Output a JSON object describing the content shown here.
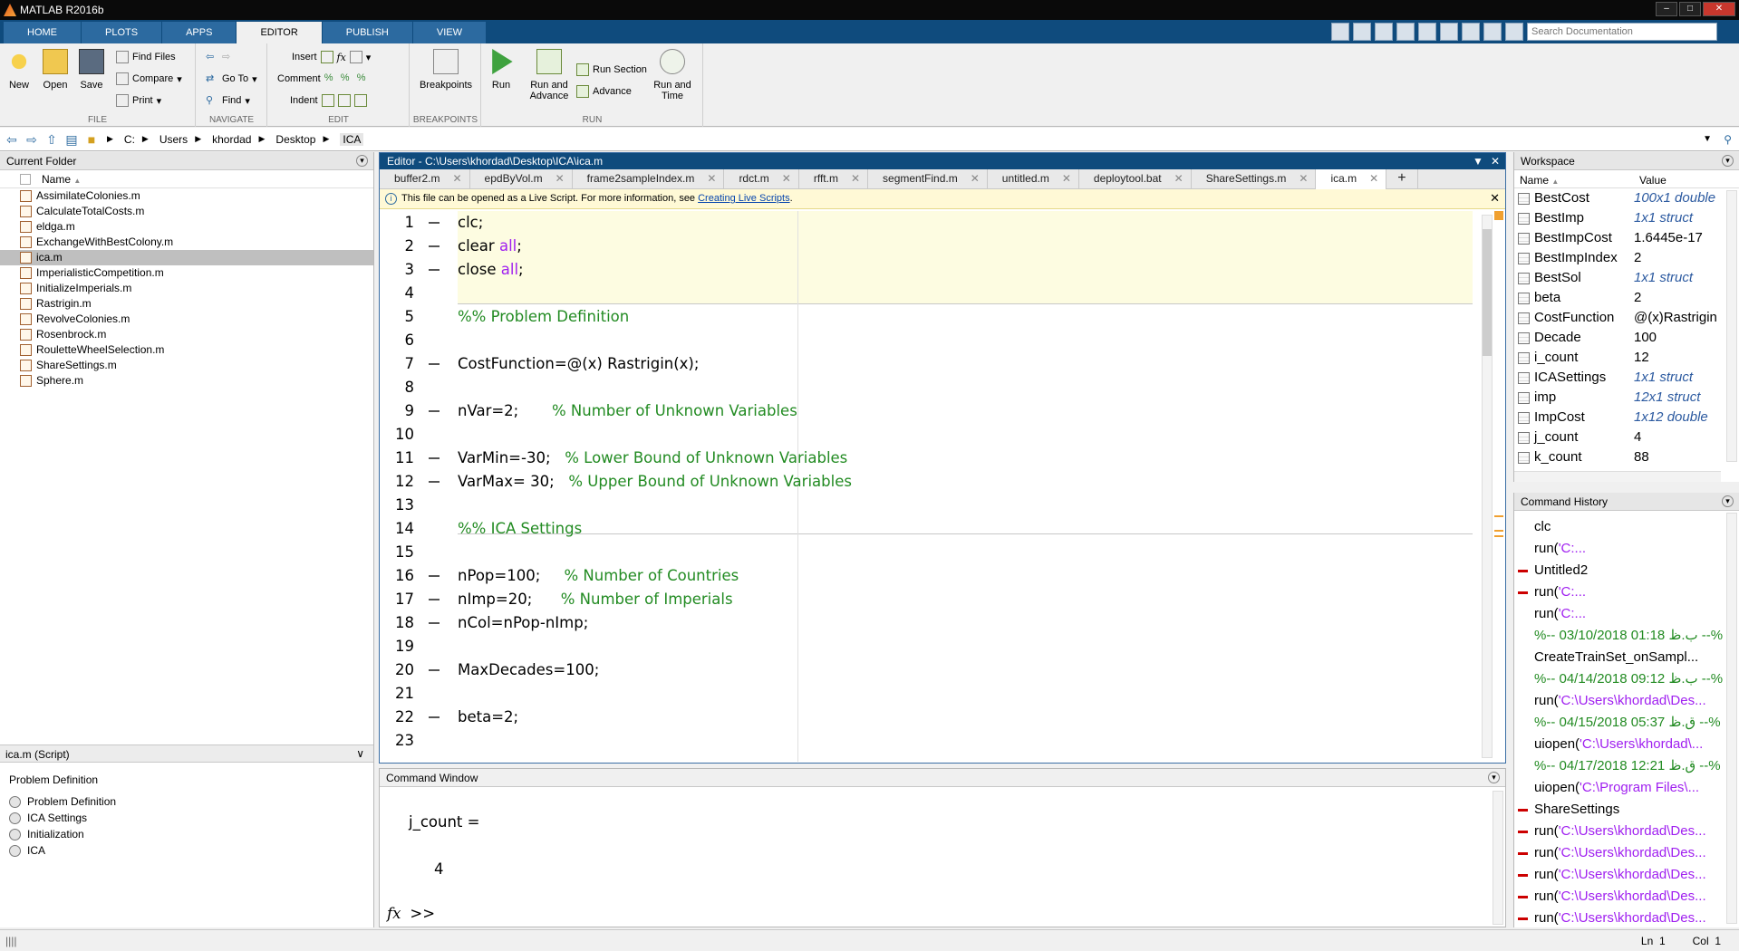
{
  "window": {
    "title": "MATLAB R2016b"
  },
  "ribbon_tabs": [
    {
      "label": "HOME"
    },
    {
      "label": "PLOTS"
    },
    {
      "label": "APPS"
    },
    {
      "label": "EDITOR"
    },
    {
      "label": "PUBLISH"
    },
    {
      "label": "VIEW"
    }
  ],
  "search": {
    "placeholder": "Search Documentation"
  },
  "ribbon": {
    "file": {
      "label": "FILE",
      "new": "New",
      "open": "Open",
      "save": "Save",
      "find_files": "Find Files",
      "compare": "Compare",
      "print": "Print"
    },
    "navigate": {
      "label": "NAVIGATE",
      "go_to": "Go To",
      "find": "Find"
    },
    "edit": {
      "label": "EDIT",
      "insert": "Insert",
      "comment": "Comment",
      "indent": "Indent"
    },
    "breakpoints": {
      "label": "BREAKPOINTS",
      "breakpoints": "Breakpoints"
    },
    "run": {
      "label": "RUN",
      "run": "Run",
      "run_and_advance_1": "Run and",
      "run_and_advance_2": "Advance",
      "run_section": "Run Section",
      "advance": "Advance",
      "run_and_time_1": "Run and",
      "run_and_time_2": "Time"
    }
  },
  "address": {
    "crumbs": [
      "C:",
      "Users",
      "khordad",
      "Desktop",
      "ICA"
    ]
  },
  "current_folder": {
    "title": "Current Folder",
    "name_col": "Name",
    "files": [
      {
        "name": "AssimilateColonies.m"
      },
      {
        "name": "CalculateTotalCosts.m"
      },
      {
        "name": "eldga.m"
      },
      {
        "name": "ExchangeWithBestColony.m"
      },
      {
        "name": "ica.m"
      },
      {
        "name": "ImperialisticCompetition.m"
      },
      {
        "name": "InitializeImperials.m"
      },
      {
        "name": "Rastrigin.m"
      },
      {
        "name": "RevolveColonies.m"
      },
      {
        "name": "Rosenbrock.m"
      },
      {
        "name": "RouletteWheelSelection.m"
      },
      {
        "name": "ShareSettings.m"
      },
      {
        "name": "Sphere.m"
      }
    ],
    "detail_label": "ica.m  (Script)",
    "detail_title": "Problem Definition",
    "outline": [
      {
        "label": "Problem Definition"
      },
      {
        "label": "ICA Settings"
      },
      {
        "label": "Initialization"
      },
      {
        "label": "ICA"
      }
    ]
  },
  "editor": {
    "title": "Editor - C:\\Users\\khordad\\Desktop\\ICA\\ica.m",
    "tabs": [
      {
        "label": "buffer2.m"
      },
      {
        "label": "epdByVol.m"
      },
      {
        "label": "frame2sampleIndex.m"
      },
      {
        "label": "rdct.m"
      },
      {
        "label": "rfft.m"
      },
      {
        "label": "segmentFind.m"
      },
      {
        "label": "untitled.m"
      },
      {
        "label": "deploytool.bat"
      },
      {
        "label": "ShareSettings.m"
      },
      {
        "label": "ica.m"
      }
    ],
    "info_text": "This file can be opened as a Live Script. For more information, see ",
    "info_link": "Creating Live Scripts",
    "info_end": ".",
    "lines": [
      {
        "n": "1",
        "code": "clc;"
      },
      {
        "n": "2",
        "code": "clear ",
        "kw": "all",
        "tail": ";"
      },
      {
        "n": "3",
        "code": "close ",
        "kw": "all",
        "tail": ";"
      },
      {
        "n": "4",
        "code": ""
      },
      {
        "n": "5",
        "comment": "%% Problem Definition"
      },
      {
        "n": "6",
        "code": ""
      },
      {
        "n": "7",
        "code": "CostFunction=@(x) Rastrigin(x);"
      },
      {
        "n": "8",
        "code": ""
      },
      {
        "n": "9",
        "code": "nVar=2;       ",
        "comment": "% Number of Unknown Variables"
      },
      {
        "n": "10",
        "code": ""
      },
      {
        "n": "11",
        "code": "VarMin=-30;   ",
        "comment": "% Lower Bound of Unknown Variables"
      },
      {
        "n": "12",
        "code": "VarMax= 30;   ",
        "comment": "% Upper Bound of Unknown Variables"
      },
      {
        "n": "13",
        "code": ""
      },
      {
        "n": "14",
        "comment": "%% ICA Settings"
      },
      {
        "n": "15",
        "code": ""
      },
      {
        "n": "16",
        "code": "nPop=100;     ",
        "comment": "% Number of Countries"
      },
      {
        "n": "17",
        "code": "nImp=20;      ",
        "comment": "% Number of Imperials"
      },
      {
        "n": "18",
        "code": "nCol=nPop-nImp;"
      },
      {
        "n": "19",
        "code": ""
      },
      {
        "n": "20",
        "code": "MaxDecades=100;"
      },
      {
        "n": "21",
        "code": ""
      },
      {
        "n": "22",
        "code": "beta=2;"
      },
      {
        "n": "23",
        "code": ""
      }
    ]
  },
  "command_window": {
    "title": "Command Window",
    "output_var": "j_count =",
    "output_val": "4",
    "prompt_fx": "fx",
    "prompt": ">>"
  },
  "workspace": {
    "title": "Workspace",
    "name_col": "Name",
    "value_col": "Value",
    "vars": [
      {
        "name": "BestCost",
        "value": "100x1 double",
        "italic": true
      },
      {
        "name": "BestImp",
        "value": "1x1 struct",
        "italic": true
      },
      {
        "name": "BestImpCost",
        "value": "1.6445e-17",
        "italic": false
      },
      {
        "name": "BestImpIndex",
        "value": "2",
        "italic": false
      },
      {
        "name": "BestSol",
        "value": "1x1 struct",
        "italic": true
      },
      {
        "name": "beta",
        "value": "2",
        "italic": false
      },
      {
        "name": "CostFunction",
        "value": "@(x)Rastrigin",
        "italic": false
      },
      {
        "name": "Decade",
        "value": "100",
        "italic": false
      },
      {
        "name": "i_count",
        "value": "12",
        "italic": false
      },
      {
        "name": "ICASettings",
        "value": "1x1 struct",
        "italic": true
      },
      {
        "name": "imp",
        "value": "12x1 struct",
        "italic": true
      },
      {
        "name": "ImpCost",
        "value": "1x12 double",
        "italic": true
      },
      {
        "name": "j_count",
        "value": "4",
        "italic": false
      },
      {
        "name": "k_count",
        "value": "88",
        "italic": false
      }
    ]
  },
  "history": {
    "title": "Command History",
    "items": [
      {
        "cmd": "clc",
        "mark": false
      },
      {
        "cmd": "run(",
        "str": "'C:...",
        "mark": false
      },
      {
        "cmd": "Untitled2",
        "mark": true
      },
      {
        "cmd": "run(",
        "str": "'C:...",
        "mark": true
      },
      {
        "cmd": "run(",
        "str": "'C:...",
        "mark": false
      },
      {
        "stamp": "%-- 03/10/2018 01:18 ب.ظ --%"
      },
      {
        "cmd": "CreateTrainSet_onSampl...",
        "mark": false
      },
      {
        "stamp": "%-- 04/14/2018 09:12 ب.ظ --%"
      },
      {
        "cmd": "run(",
        "str": "'C:\\Users\\khordad\\Des...",
        "mark": false
      },
      {
        "stamp": "%-- 04/15/2018 05:37 ق.ظ --%"
      },
      {
        "cmd": "uiopen(",
        "str": "'C:\\Users\\khordad\\...",
        "mark": false
      },
      {
        "stamp": "%-- 04/17/2018 12:21 ق.ظ --%"
      },
      {
        "cmd": "uiopen(",
        "str": "'C:\\Program Files\\...",
        "mark": false
      },
      {
        "cmd": "ShareSettings",
        "mark": true
      },
      {
        "cmd": "run(",
        "str": "'C:\\Users\\khordad\\Des...",
        "mark": true
      },
      {
        "cmd": "run(",
        "str": "'C:\\Users\\khordad\\Des...",
        "mark": true
      },
      {
        "cmd": "run(",
        "str": "'C:\\Users\\khordad\\Des...",
        "mark": true
      },
      {
        "cmd": "run(",
        "str": "'C:\\Users\\khordad\\Des...",
        "mark": true
      },
      {
        "cmd": "run(",
        "str": "'C:\\Users\\khordad\\Des...",
        "mark": true
      }
    ]
  },
  "status": {
    "ln_label": "Ln",
    "ln": "1",
    "col_label": "Col",
    "col": "1",
    "busy": "||||"
  }
}
